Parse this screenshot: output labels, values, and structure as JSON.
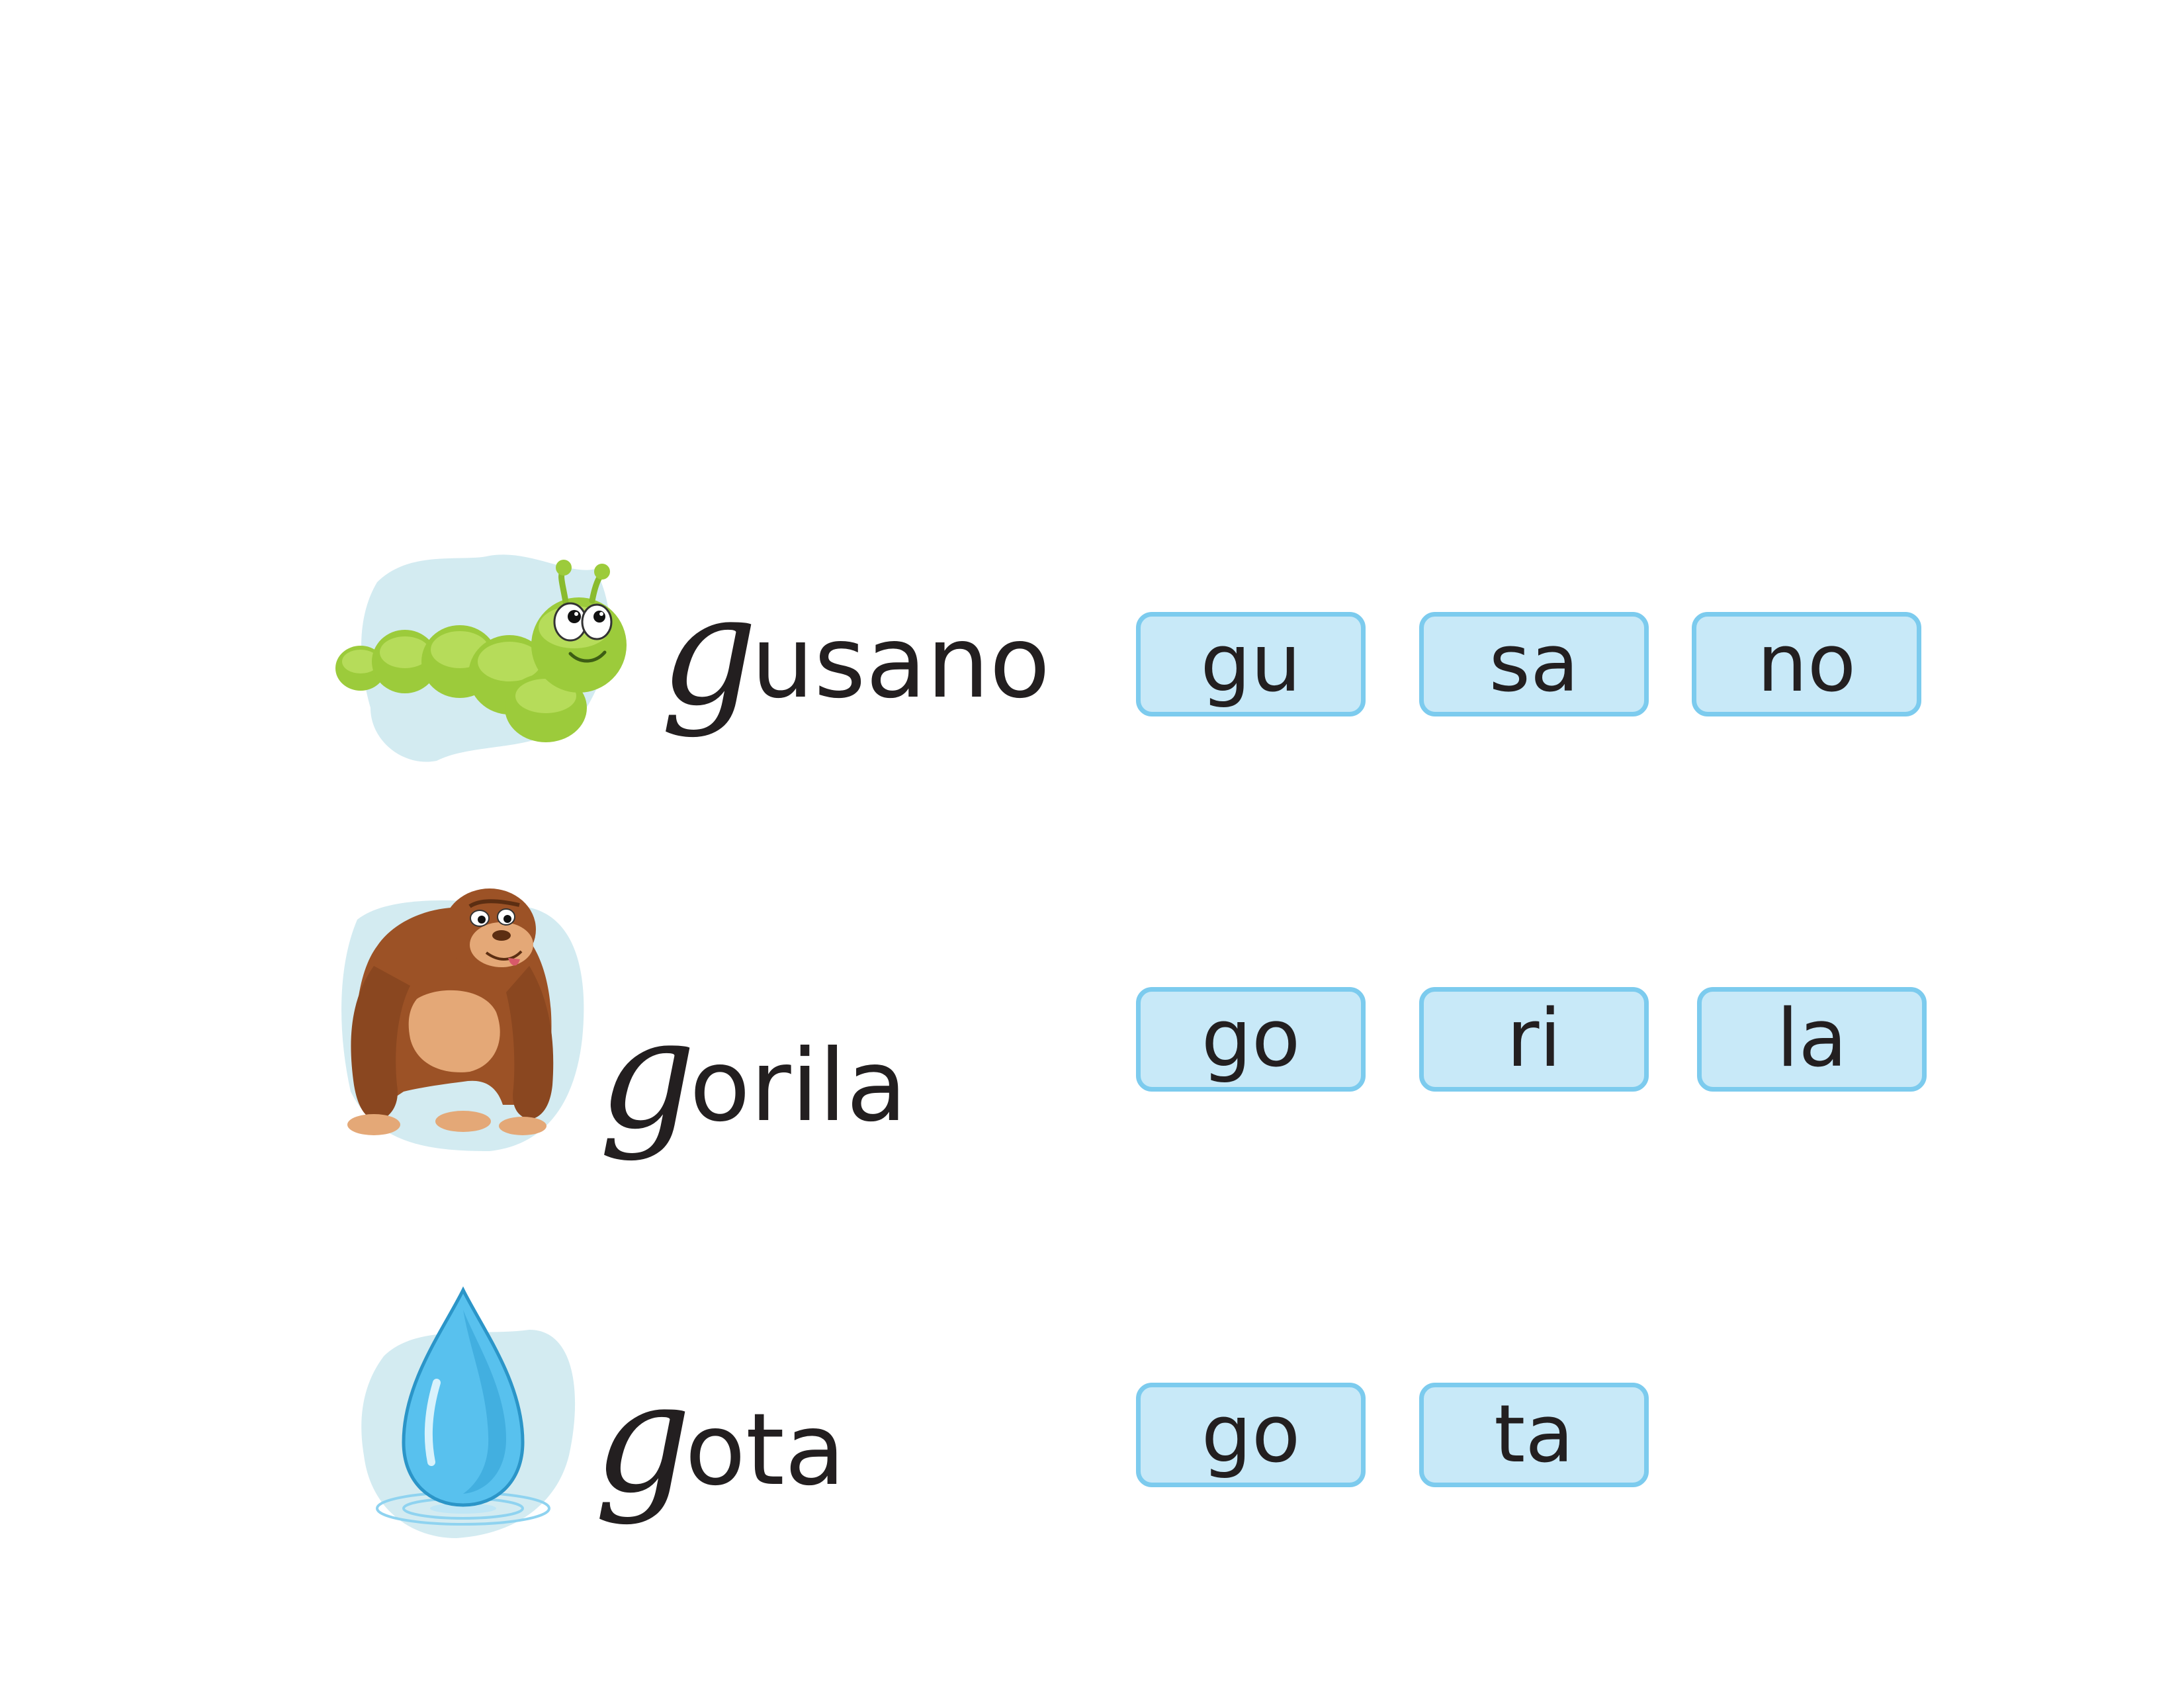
{
  "rows": [
    {
      "illustration": "caterpillar-icon",
      "word": {
        "initial": "g",
        "rest": "usano"
      },
      "syllables": [
        "gu",
        "sa",
        "no"
      ]
    },
    {
      "illustration": "gorilla-icon",
      "word": {
        "initial": "g",
        "rest": "orila"
      },
      "syllables": [
        "go",
        "ri",
        "la"
      ]
    },
    {
      "illustration": "water-drop-icon",
      "word": {
        "initial": "g",
        "rest": "ota"
      },
      "syllables": [
        "go",
        "ta"
      ]
    }
  ],
  "colors": {
    "syllable_fill": "#c8e9f8",
    "syllable_border": "#7ccbee",
    "text": "#231f20",
    "caterpillar": "#9ccb3b",
    "gorilla": "#9c5226",
    "drop": "#58c1ee"
  }
}
